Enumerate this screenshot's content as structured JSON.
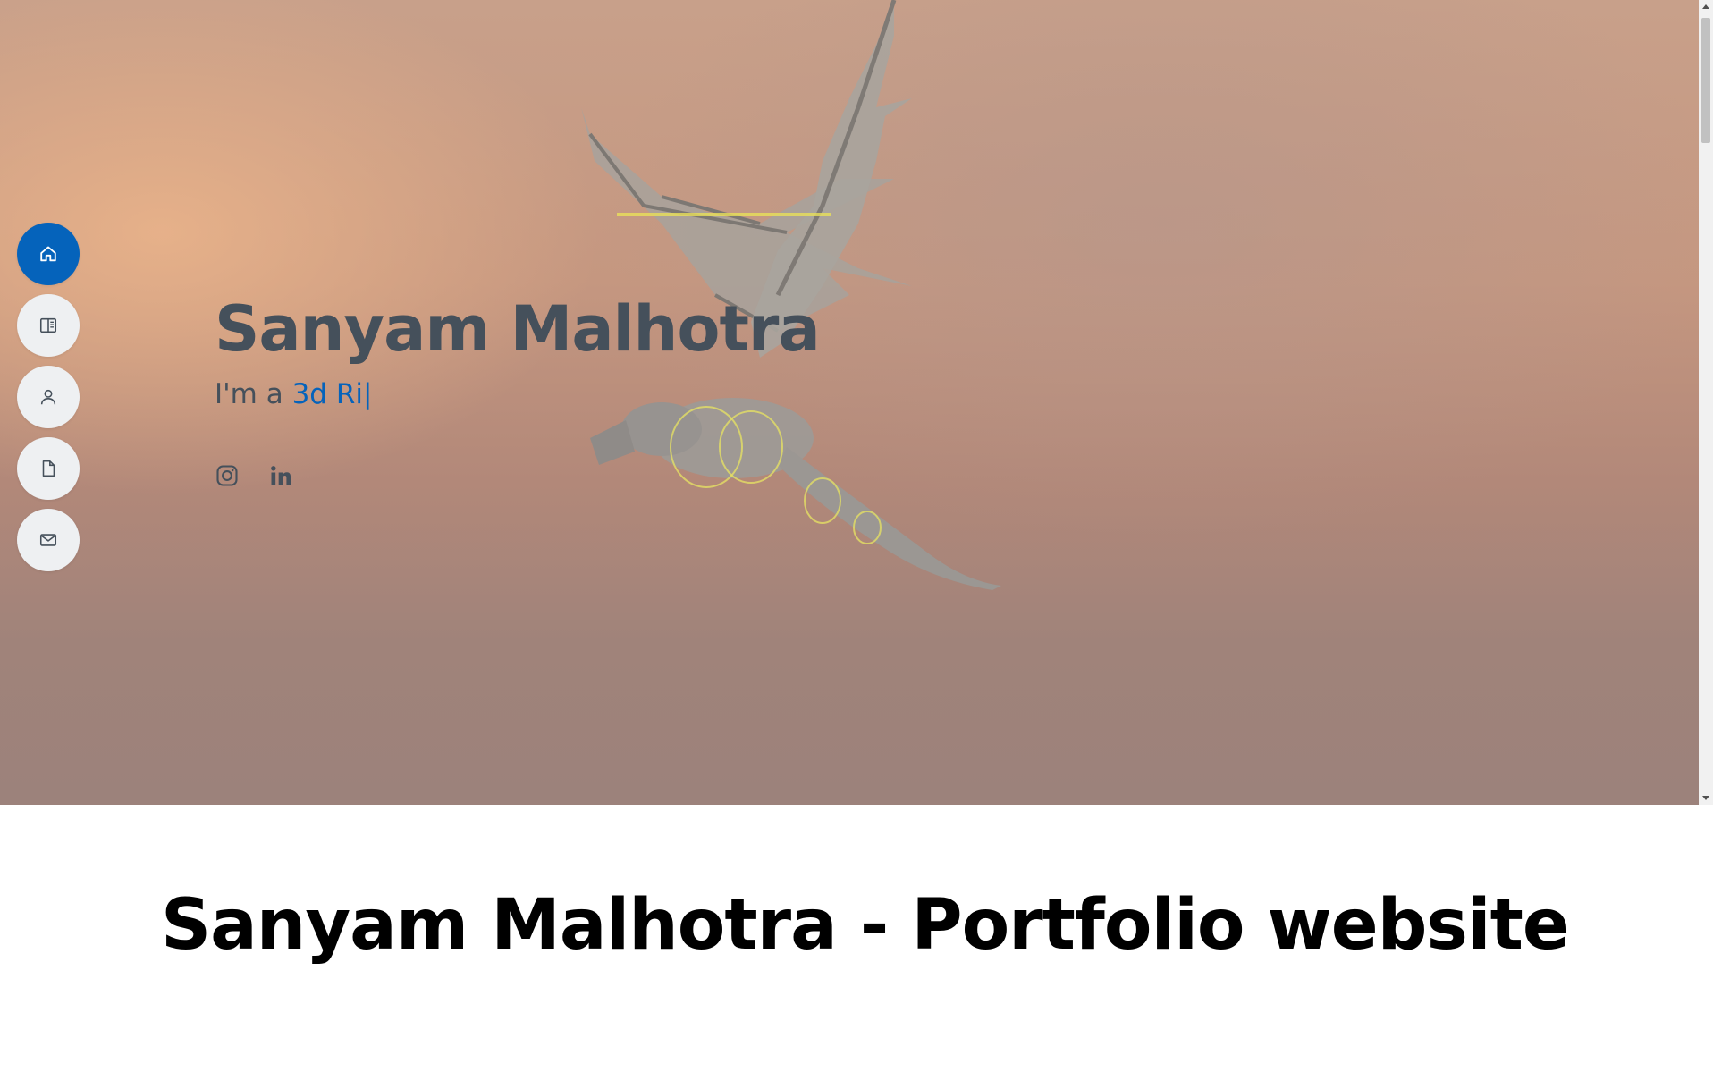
{
  "hero": {
    "title": "Sanyam Malhotra",
    "subtitle_prefix": "I'm a ",
    "typed_text": "3d Ri",
    "caret": "|"
  },
  "nav": {
    "items": [
      {
        "icon": "home-icon",
        "active": true
      },
      {
        "icon": "resume-icon",
        "active": false
      },
      {
        "icon": "person-icon",
        "active": false
      },
      {
        "icon": "file-icon",
        "active": false
      },
      {
        "icon": "envelope-icon",
        "active": false
      }
    ]
  },
  "social": {
    "items": [
      {
        "icon": "instagram-icon"
      },
      {
        "icon": "linkedin-icon"
      }
    ]
  },
  "page": {
    "heading": "Sanyam Malhotra - Portfolio website"
  },
  "colors": {
    "accent": "#0563bb",
    "text": "#45505b"
  }
}
